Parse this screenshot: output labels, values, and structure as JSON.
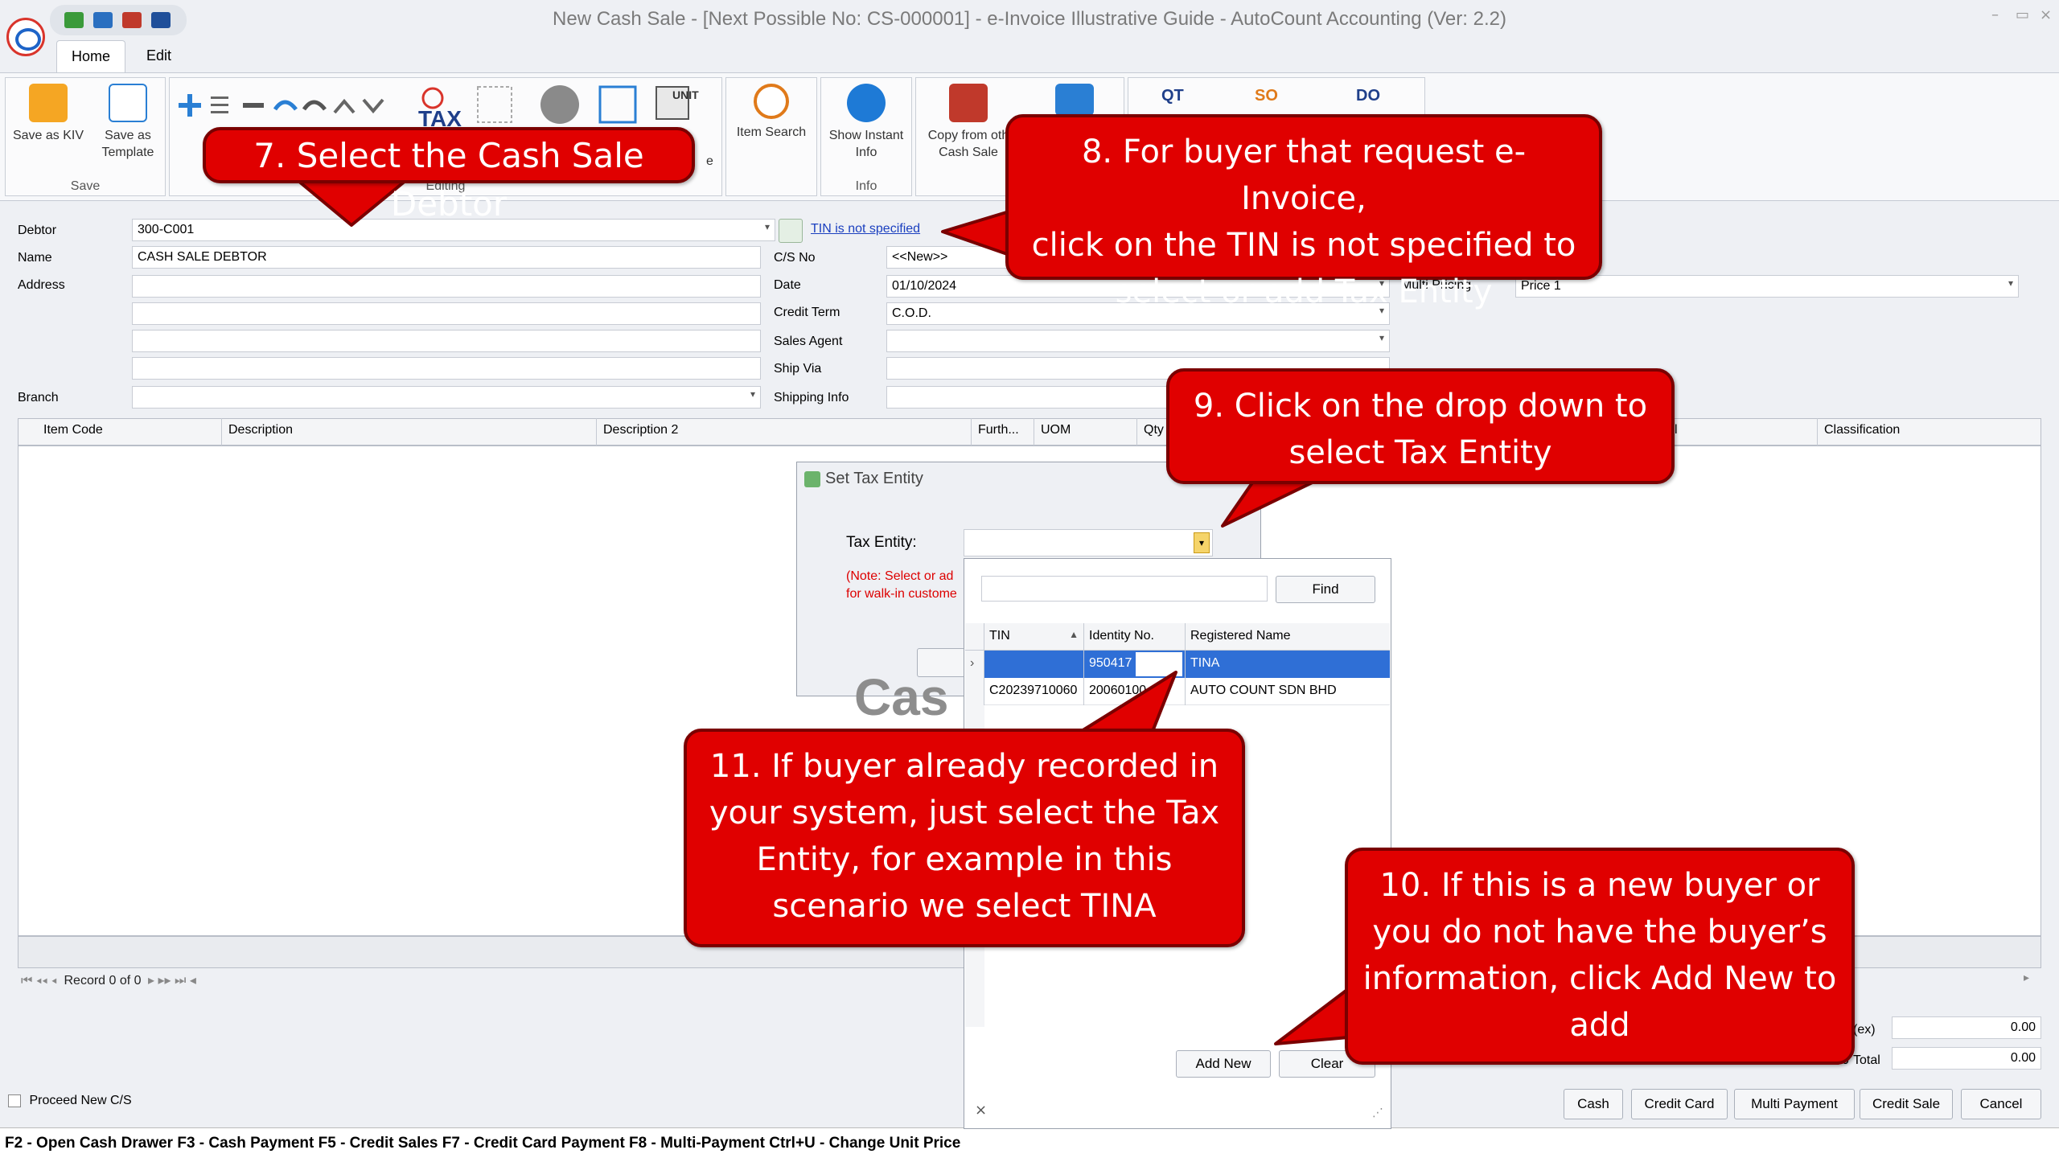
{
  "window": {
    "title": "New Cash Sale - [Next Possible No: CS-000001] - e-Invoice Illustrative Guide - AutoCount Accounting (Ver: 2.2)",
    "controls": [
      "–",
      "▭",
      "×"
    ]
  },
  "tabs": [
    "Home",
    "Edit"
  ],
  "ribbon": {
    "save_as_kiv": "Save as KIV",
    "save_as_template_1": "Save as",
    "save_as_template_2": "Template",
    "group_save": "Save",
    "item_search": "Item Search",
    "show_instant_info_1": "Show Instant",
    "show_instant_info_2": "Info",
    "group_info": "Info",
    "copy_from_1": "Copy from oth",
    "copy_from_2": "Cash Sale",
    "e_label": "e",
    "editing_group_partial": "Editing",
    "tax_icon_label": "TAX",
    "unit_icon_label": "UNIT",
    "qt_label": "QT",
    "so_label": "SO",
    "do_label": "DO"
  },
  "form": {
    "debtor_label": "Debtor",
    "debtor_value": "300-C001",
    "tin_link": "TIN is not specified",
    "name_label": "Name",
    "name_value": "CASH SALE DEBTOR",
    "address_label": "Address",
    "branch_label": "Branch",
    "cs_no_label": "C/S No",
    "cs_no_value": "<<New>>",
    "date_label": "Date",
    "date_value": "01/10/2024",
    "credit_term_label": "Credit Term",
    "credit_term_value": "C.O.D.",
    "sales_agent_label": "Sales Agent",
    "ship_via_label": "Ship Via",
    "shipping_info_label": "Shipping Info",
    "multi_pricing_label": "Multi Pricing",
    "multi_pricing_value": "Price 1"
  },
  "grid": {
    "columns": [
      "Item Code",
      "Description",
      "Description 2",
      "Furth...",
      "UOM",
      "Qty",
      "l",
      "Classification"
    ],
    "record_text": "Record 0 of 0"
  },
  "totals": {
    "ex_label": "(ex)",
    "ex_value": "0.00",
    "total_label": "Total",
    "total_value": "0.00",
    "partial_0": "0"
  },
  "proceed_new": "Proceed New C/S",
  "bottom_buttons": [
    "Cash",
    "Credit Card",
    "Multi Payment",
    "Credit Sale",
    "Cancel"
  ],
  "status_bar": "F2 - Open Cash Drawer   F3 - Cash Payment   F5 - Credit Sales   F7 - Credit Card Payment   F8 - Multi-Payment   Ctrl+U - Change Unit Price",
  "dialog": {
    "title": "Set Tax Entity",
    "tax_entity_label": "Tax Entity:",
    "note_line1": "(Note: Select or ad",
    "note_line2": "for walk-in custome",
    "watermark_partial": "Cas"
  },
  "popup": {
    "find_button": "Find",
    "columns": [
      "TIN",
      "Identity No.",
      "Registered Name"
    ],
    "rows": [
      {
        "tin": "",
        "identity": "950417",
        "name": "TINA"
      },
      {
        "tin": "C20239710060",
        "identity": "20060100",
        "name": "AUTO COUNT SDN BHD"
      }
    ],
    "add_new": "Add New",
    "clear": "Clear",
    "close_x": "×"
  },
  "callouts": {
    "c7": "7. Select the Cash Sale Debtor",
    "c8_1": "8. For buyer that request e-Invoice,",
    "c8_2": "click on the TIN is not specified to",
    "c8_3": "select or add Tax Entity",
    "c9_1": "9. Click on the drop down to",
    "c9_2": "select Tax Entity",
    "c10_1": "10. If this is a new buyer or",
    "c10_2": "you do not have the buyer’s",
    "c10_3": "information, click Add New to",
    "c10_4": "add",
    "c11_1": "11. If buyer already recorded in",
    "c11_2": "your system, just select the Tax",
    "c11_3": "Entity, for example in this",
    "c11_4": "scenario we select TINA"
  },
  "colors": {
    "callout_red": "#e00000",
    "selected_row": "#2f6fd6",
    "link_blue": "#1a3fbf"
  }
}
